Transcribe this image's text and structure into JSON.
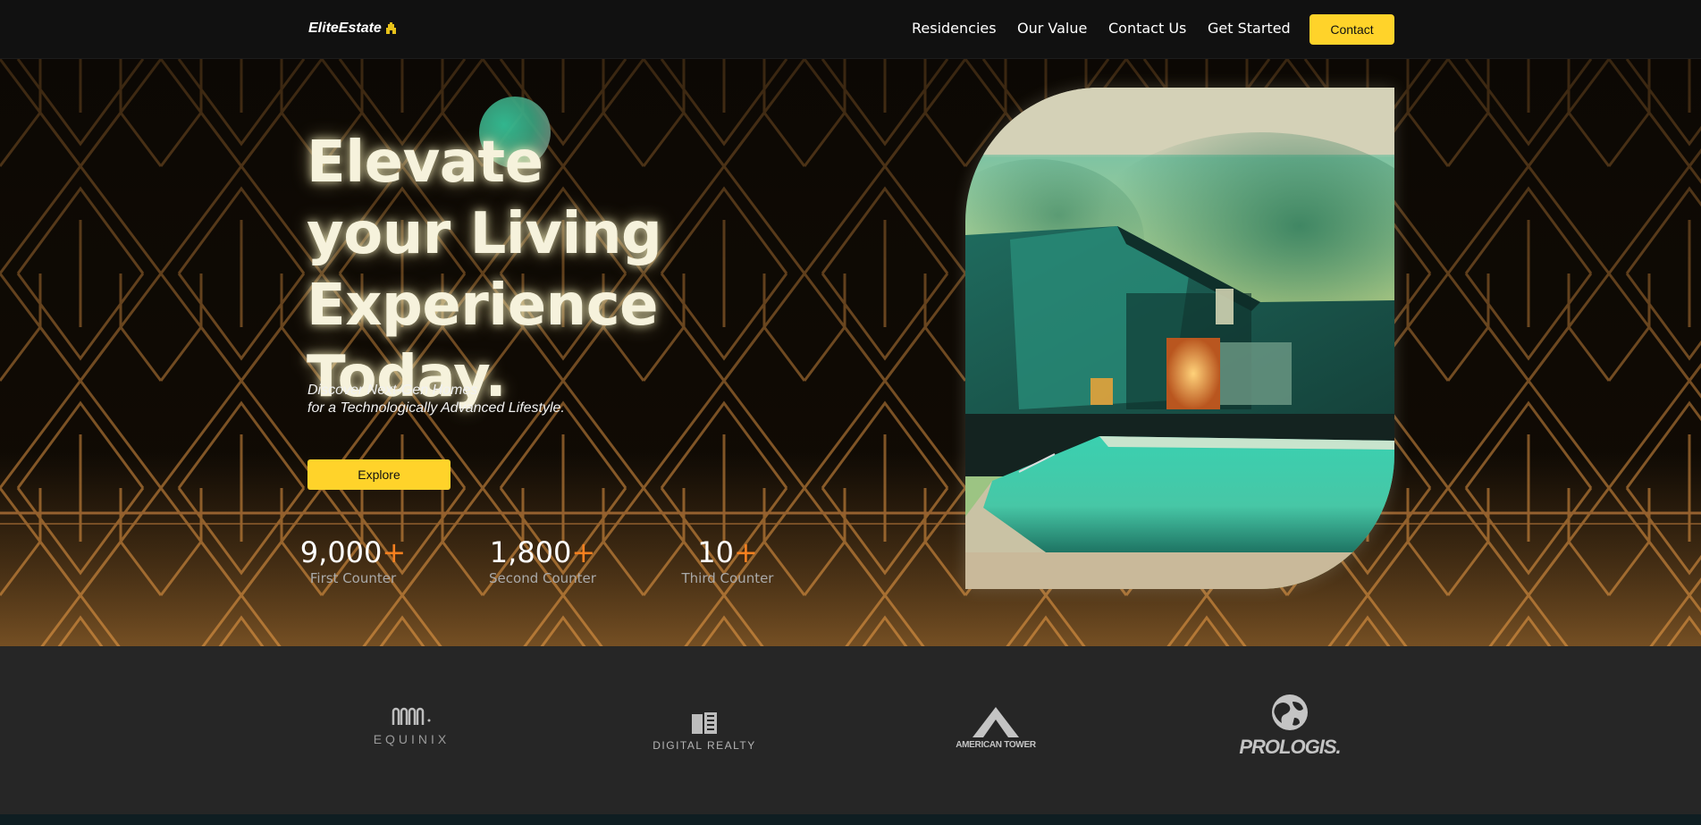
{
  "nav": {
    "logo": "EliteEstate",
    "links": [
      "Residencies",
      "Our Value",
      "Contact Us",
      "Get Started"
    ],
    "contact_button": "Contact"
  },
  "hero": {
    "headline": [
      "Elevate",
      "your Living",
      "Experience Today."
    ],
    "subtitle": [
      "Discover Next-Gen Homes",
      "for a Technologically Advanced Lifestyle."
    ],
    "explore_button": "Explore",
    "stats": [
      {
        "value": "9,000",
        "plus": "+",
        "label": "First Counter"
      },
      {
        "value": "1,800",
        "plus": "+",
        "label": "Second Counter"
      },
      {
        "value": "10",
        "plus": "+",
        "label": "Third Counter"
      }
    ]
  },
  "partners": [
    {
      "name": "EQUINIX",
      "icon": "equinix-logo-icon"
    },
    {
      "name": "DIGITAL REALTY",
      "icon": "digital-realty-logo-icon"
    },
    {
      "name": "AMERICAN TOWER",
      "icon": "american-tower-logo-icon"
    },
    {
      "name": "PROLOGIS.",
      "icon": "prologis-globe-icon"
    }
  ],
  "colors": {
    "accent": "#ffd32a",
    "plus": "#f7801f",
    "nav_bg": "#111111",
    "logos_bg": "#262626",
    "pattern": "#c8843a"
  }
}
